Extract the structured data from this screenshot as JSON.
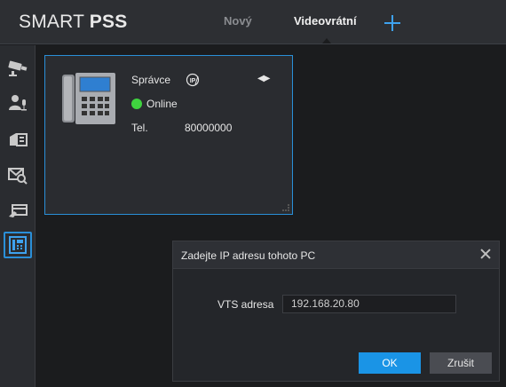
{
  "app": {
    "logo_light": "SMART ",
    "logo_bold": "PSS"
  },
  "tabs": [
    {
      "label": "Nový",
      "active": false
    },
    {
      "label": "Videovrátní",
      "active": true
    }
  ],
  "sidebar": {
    "items": [
      {
        "icon": "camera-icon"
      },
      {
        "icon": "user-mic-icon"
      },
      {
        "icon": "card-reader-icon"
      },
      {
        "icon": "mail-search-icon"
      },
      {
        "icon": "card-swipe-icon"
      },
      {
        "icon": "intercom-icon",
        "active": true
      }
    ]
  },
  "device_card": {
    "name": "Správce",
    "status": "Online",
    "tel_label": "Tel.",
    "tel_value": "80000000",
    "nav_arrows": "◀▶",
    "status_color": "#3fd33f"
  },
  "dialog": {
    "title": "Zadejte IP adresu tohoto PC",
    "field_label": "VTS adresa",
    "field_value": "192.168.20.80",
    "ok_label": "OK",
    "cancel_label": "Zrušit"
  },
  "colors": {
    "accent": "#2a8fd8",
    "ok_button": "#1a94e6"
  }
}
